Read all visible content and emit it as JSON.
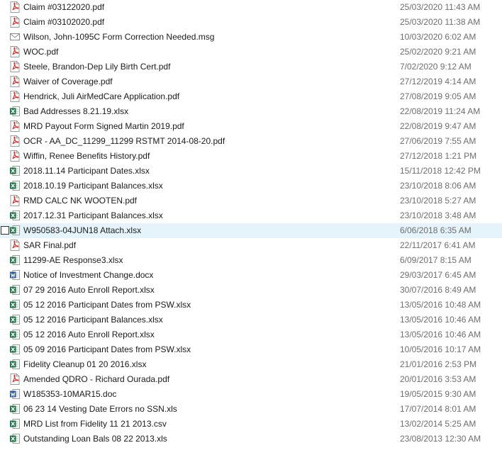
{
  "colors": {
    "pdf_red": "#d9342b",
    "excel_green": "#1e7145",
    "word_blue": "#2b579a",
    "date_gray": "#6d6d6d",
    "selection_bg": "#e5f3fb"
  },
  "files": [
    {
      "name": "Claim #03122020.pdf",
      "date": "25/03/2020 11:43 AM",
      "icon": "pdf-icon"
    },
    {
      "name": "Claim #03102020.pdf",
      "date": "25/03/2020 11:38 AM",
      "icon": "pdf-icon"
    },
    {
      "name": "Wilson, John-1095C Form Correction Needed.msg",
      "date": "10/03/2020 6:02 AM",
      "icon": "mail-icon"
    },
    {
      "name": "WOC.pdf",
      "date": "25/02/2020 9:21 AM",
      "icon": "pdf-icon"
    },
    {
      "name": "Steele, Brandon-Dep Lily Birth Cert.pdf",
      "date": "7/02/2020 9:12 AM",
      "icon": "pdf-icon"
    },
    {
      "name": "Waiver of Coverage.pdf",
      "date": "27/12/2019 4:14 AM",
      "icon": "pdf-icon"
    },
    {
      "name": "Hendrick, Juli AirMedCare Application.pdf",
      "date": "27/08/2019 9:05 AM",
      "icon": "pdf-icon"
    },
    {
      "name": "Bad Addresses 8.21.19.xlsx",
      "date": "22/08/2019 11:24 AM",
      "icon": "excel-icon"
    },
    {
      "name": "MRD Payout Form Signed Martin 2019.pdf",
      "date": "22/08/2019 9:47 AM",
      "icon": "pdf-icon"
    },
    {
      "name": "OCR - AA_DC_11299_11299 RSTMT 2014-08-20.pdf",
      "date": "27/06/2019 7:55 AM",
      "icon": "pdf-icon"
    },
    {
      "name": "Wiffin, Renee Benefits History.pdf",
      "date": "27/12/2018 1:21 PM",
      "icon": "pdf-icon"
    },
    {
      "name": "2018.11.14 Participant Dates.xlsx",
      "date": "15/11/2018 12:42 PM",
      "icon": "excel-icon"
    },
    {
      "name": "2018.10.19 Participant Balances.xlsx",
      "date": "23/10/2018 8:06 AM",
      "icon": "excel-icon"
    },
    {
      "name": "RMD CALC NK WOOTEN.pdf",
      "date": "23/10/2018 5:27 AM",
      "icon": "pdf-icon"
    },
    {
      "name": "2017.12.31 Participant Balances.xlsx",
      "date": "23/10/2018 3:48 AM",
      "icon": "excel-icon"
    },
    {
      "name": "W950583-04JUN18 Attach.xlsx",
      "date": "6/06/2018 6:35 AM",
      "icon": "excel-icon",
      "selected": true
    },
    {
      "name": "SAR Final.pdf",
      "date": "22/11/2017 6:41 AM",
      "icon": "pdf-icon"
    },
    {
      "name": "11299-AE Response3.xlsx",
      "date": "6/09/2017 8:15 AM",
      "icon": "excel-icon"
    },
    {
      "name": "Notice of Investment Change.docx",
      "date": "29/03/2017 6:45 AM",
      "icon": "word-icon"
    },
    {
      "name": "07 29 2016 Auto Enroll Report.xlsx",
      "date": "30/07/2016 8:49 AM",
      "icon": "excel-icon"
    },
    {
      "name": "05 12 2016 Participant Dates from PSW.xlsx",
      "date": "13/05/2016 10:48 AM",
      "icon": "excel-icon"
    },
    {
      "name": "05 12 2016 Participant Balances.xlsx",
      "date": "13/05/2016 10:46 AM",
      "icon": "excel-icon"
    },
    {
      "name": "05 12 2016 Auto Enroll Report.xlsx",
      "date": "13/05/2016 10:46 AM",
      "icon": "excel-icon"
    },
    {
      "name": "05 09 2016 Participant Dates from PSW.xlsx",
      "date": "10/05/2016 10:17 AM",
      "icon": "excel-icon"
    },
    {
      "name": "Fidelity Cleanup 01 20 2016.xlsx",
      "date": "21/01/2016 2:53 PM",
      "icon": "excel-icon"
    },
    {
      "name": "Amended QDRO - Richard Ourada.pdf",
      "date": "20/01/2016 3:53 AM",
      "icon": "pdf-icon"
    },
    {
      "name": "W185353-10MAR15.doc",
      "date": "19/05/2015 9:30 AM",
      "icon": "word-icon"
    },
    {
      "name": "06 23 14 Vesting Date Errors no SSN.xls",
      "date": "17/07/2014 8:01 AM",
      "icon": "excel-icon"
    },
    {
      "name": "MRD List from Fidelity 11 21 2013.csv",
      "date": "13/02/2014 5:25 AM",
      "icon": "csv-icon"
    },
    {
      "name": "Outstanding Loan Bals 08 22 2013.xls",
      "date": "23/08/2013 12:30 AM",
      "icon": "excel-icon"
    }
  ]
}
